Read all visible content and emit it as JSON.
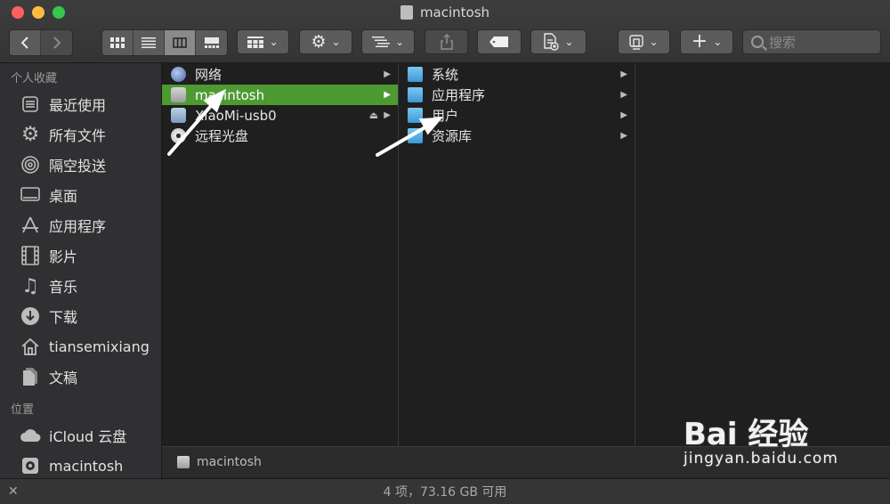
{
  "window": {
    "title": "macintosh"
  },
  "toolbar": {
    "search_placeholder": "搜索"
  },
  "sidebar": {
    "favorites_header": "个人收藏",
    "favorites": [
      {
        "label": "最近使用",
        "icon": "recents-icon"
      },
      {
        "label": "所有文件",
        "icon": "gear-icon"
      },
      {
        "label": "隔空投送",
        "icon": "airdrop-icon"
      },
      {
        "label": "桌面",
        "icon": "desktop-icon"
      },
      {
        "label": "应用程序",
        "icon": "applications-icon"
      },
      {
        "label": "影片",
        "icon": "film-icon"
      },
      {
        "label": "音乐",
        "icon": "music-icon"
      },
      {
        "label": "下载",
        "icon": "download-icon"
      },
      {
        "label": "tiansemixiang",
        "icon": "home-icon"
      },
      {
        "label": "文稿",
        "icon": "documents-icon"
      }
    ],
    "locations_header": "位置",
    "locations": [
      {
        "label": "iCloud 云盘",
        "icon": "cloud-icon"
      },
      {
        "label": "macintosh",
        "icon": "disk-icon"
      }
    ]
  },
  "columns": {
    "c1": [
      {
        "label": "网络",
        "icon": "globe-icon"
      },
      {
        "label": "macintosh",
        "icon": "disk-icon",
        "selected": true
      },
      {
        "label": "XiaoMi-usb0",
        "icon": "usb-drive-icon",
        "eject": true
      },
      {
        "label": "远程光盘",
        "icon": "disc-icon"
      }
    ],
    "c2": [
      {
        "label": "系统",
        "icon": "folder-icon"
      },
      {
        "label": "应用程序",
        "icon": "folder-icon"
      },
      {
        "label": "用户",
        "icon": "folder-icon"
      },
      {
        "label": "资源库",
        "icon": "folder-icon"
      }
    ]
  },
  "pathbar": {
    "label": "macintosh"
  },
  "status": {
    "text": "4 项，73.16 GB 可用"
  },
  "watermark": {
    "main": "Bai 经验",
    "sub": "jingyan.baidu.com"
  }
}
